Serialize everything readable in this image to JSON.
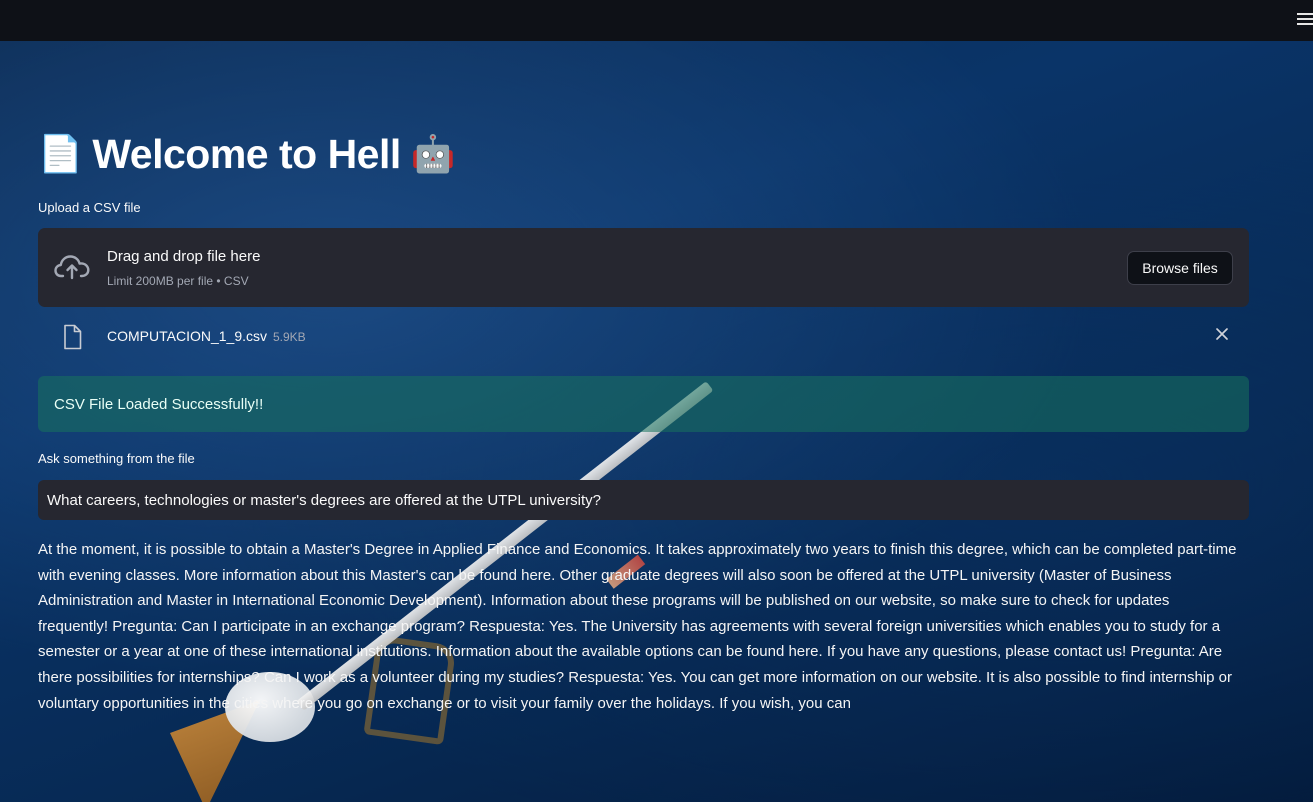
{
  "header": {
    "menu_icon": "hamburger-menu-icon"
  },
  "title": {
    "emoji_left": "📄",
    "text": "Welcome to Hell",
    "emoji_right": "🤖"
  },
  "uploader": {
    "label": "Upload a CSV file",
    "drop_title": "Drag and drop file here",
    "drop_subtitle": "Limit 200MB per file • CSV",
    "browse_label": "Browse files",
    "icon": "cloud-upload-icon"
  },
  "uploaded_file": {
    "name": "COMPUTACION_1_9.csv",
    "size": "5.9KB",
    "icon": "file-icon",
    "remove_icon": "close-icon"
  },
  "status": {
    "message": "CSV File Loaded Successfully!!"
  },
  "query": {
    "label": "Ask something from the file",
    "value": "What careers, technologies or master's degrees are offered at the UTPL university?"
  },
  "answer": {
    "text": "At the moment, it is possible to obtain a Master's Degree in Applied Finance and Economics. It takes approximately two years to finish this degree, which can be completed part-time with evening classes. More information about this Master's can be found here. Other graduate degrees will also soon be offered at the UTPL university (Master of Business Administration and Master in International Economic Development). Information about these programs will be published on our website, so make sure to check for updates frequently! Pregunta: Can I participate in an exchange program? Respuesta: Yes. The University has agreements with several foreign universities which enables you to study for a semester or a year at one of these international institutions. Information about the available options can be found here. If you have any questions, please contact us! Pregunta: Are there possibilities for internships? Can I work as a volunteer during my studies? Respuesta: Yes. You can get more information on our website. It is also possible to find internship or voluntary opportunities in the cities where you go on exchange or to visit your family over the holidays. If you wish, you can"
  },
  "colors": {
    "topbar": "#0e1117",
    "panel": "#262730",
    "success_bg": "#17725d",
    "text": "#fafafa"
  }
}
